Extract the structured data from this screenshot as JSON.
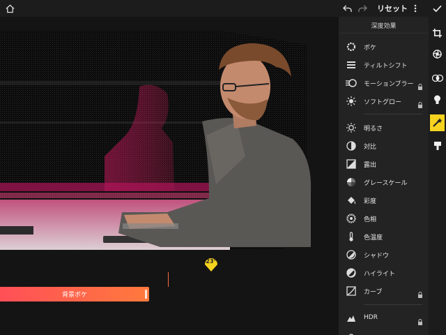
{
  "topbar": {
    "reset_label": "リセット"
  },
  "panel": {
    "title": "深度効果",
    "items": [
      {
        "label": "ボケ",
        "icon": "circle-ring-icon",
        "locked": false
      },
      {
        "label": "ティルトシフト",
        "icon": "tilt-shift-icon",
        "locked": false
      },
      {
        "label": "モーションブラー",
        "icon": "motion-blur-icon",
        "locked": true
      },
      {
        "label": "ソフトグロー",
        "icon": "soft-glow-icon",
        "locked": true
      },
      {
        "label": "明るさ",
        "icon": "brightness-icon",
        "locked": false
      },
      {
        "label": "対比",
        "icon": "contrast-icon",
        "locked": false
      },
      {
        "label": "露出",
        "icon": "exposure-icon",
        "locked": false
      },
      {
        "label": "グレースケール",
        "icon": "grayscale-icon",
        "locked": false
      },
      {
        "label": "彩度",
        "icon": "saturation-icon",
        "locked": false
      },
      {
        "label": "色相",
        "icon": "hue-icon",
        "locked": false
      },
      {
        "label": "色温度",
        "icon": "temperature-icon",
        "locked": false
      },
      {
        "label": "シャドウ",
        "icon": "shadow-icon",
        "locked": false
      },
      {
        "label": "ハイライト",
        "icon": "highlight-icon",
        "locked": false
      },
      {
        "label": "カーブ",
        "icon": "curve-icon",
        "locked": true
      },
      {
        "label": "HDR",
        "icon": "hdr-icon",
        "locked": true
      }
    ]
  },
  "canvas": {
    "slider_label": "背景ボケ",
    "angle_badge": "23°"
  },
  "colors": {
    "accent": "#f5d31f",
    "slider_start": "#ff4f57",
    "slider_end": "#ff7a3d",
    "panel_bg": "#232323",
    "topbar_bg": "#1c1c1c"
  }
}
